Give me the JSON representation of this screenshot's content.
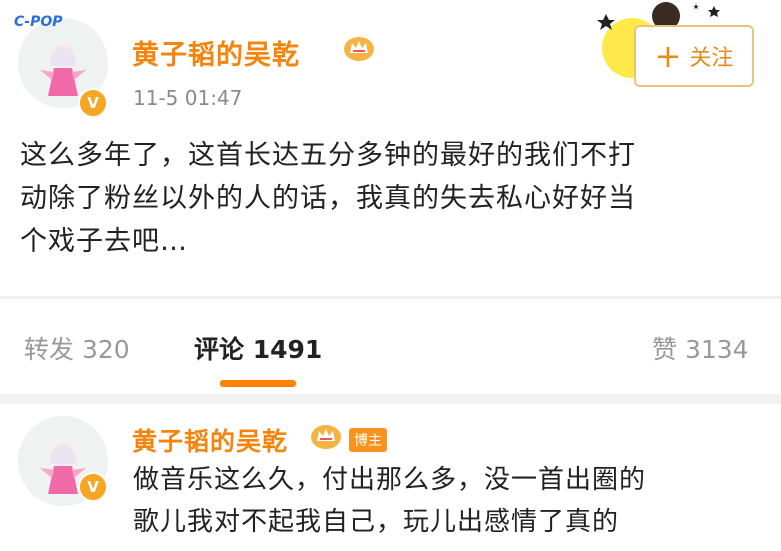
{
  "post": {
    "username": "黄子韬的吴乾",
    "time": "11-5 01:47",
    "follow_label": "关注",
    "text_line1": "这么多年了，这首长达五分多钟的最好的我们不打",
    "text_line2": "动除了粉丝以外的人的话，我真的失去私心好好当",
    "text_line3": "个戏子去吧…",
    "avatar_tag": "C-POP"
  },
  "tabs": {
    "repost": "转发 320",
    "comments": "评论 1491",
    "likes": "赞 3134"
  },
  "comment": {
    "username": "黄子韬的吴乾",
    "badge": "博主",
    "text_line1": "做音乐这么久，付出那么多，没一首出圈的",
    "text_line2": "歌儿我对不起我自己，玩儿出感情了真的"
  },
  "colors": {
    "accent": "#ff8200",
    "username": "#f5840c",
    "verified": "#f5a623"
  }
}
